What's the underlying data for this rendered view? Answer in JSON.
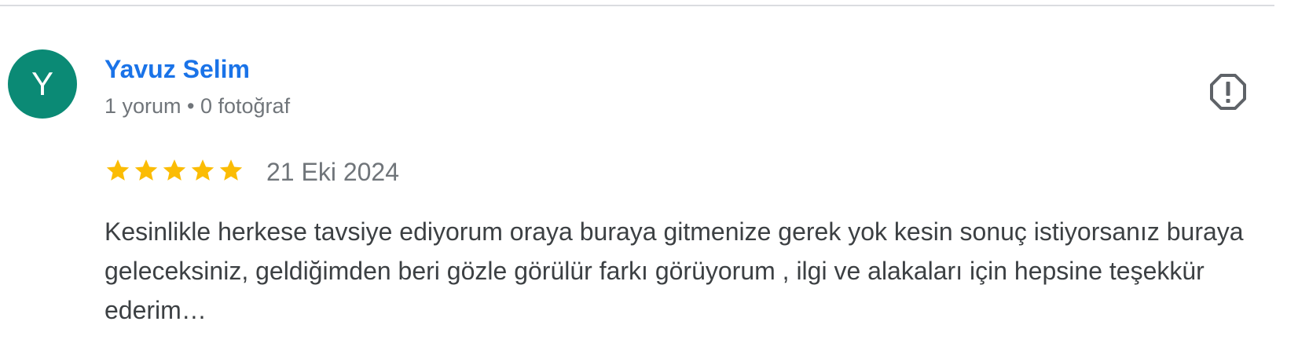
{
  "review": {
    "avatar_letter": "Y",
    "avatar_color": "#0b8a75",
    "author_name": "Yavuz Selim",
    "author_meta": "1 yorum • 0 fotoğraf",
    "rating": 5,
    "rating_max": 5,
    "star_color": "#fbbc04",
    "date": "21 Eki 2024",
    "text": "Kesinlikle herkese tavsiye ediyorum oraya buraya gitmenize gerek yok kesin sonuç istiyorsanız buraya geleceksiniz, geldiğimden beri gözle görülür farkı görüyorum , ilgi ve alakaları için hepsine teşekkür ederim…",
    "report_icon": "report-flag-icon"
  },
  "colors": {
    "name_link": "#1a73e8",
    "meta_text": "#70757a",
    "body_text": "#3c4043",
    "divider": "#dadce0"
  }
}
